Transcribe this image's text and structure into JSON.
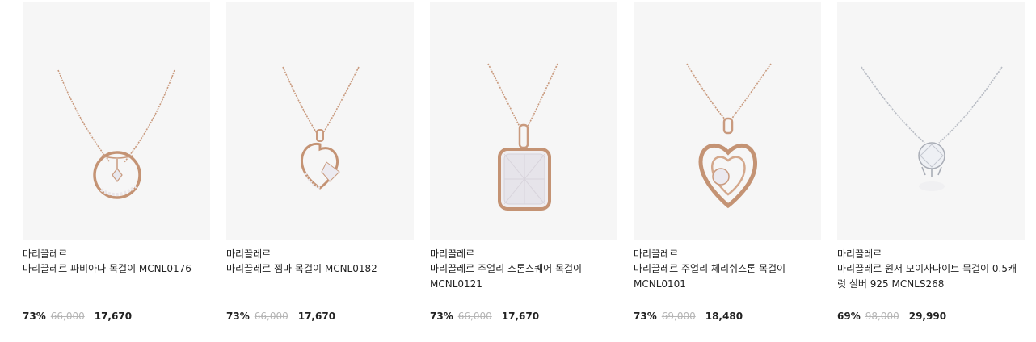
{
  "products": [
    {
      "brand": "마리끌레르",
      "name": "마리끌레르 파비아나 목걸이 MCNL0176",
      "discount": "73%",
      "original_price": "66,000",
      "sale_price": "17,670",
      "image_icon": "necklace-circle-pendant-icon",
      "metal_color": "#c99a7e"
    },
    {
      "brand": "마리끌레르",
      "name": "마리끌레르 젬마 목걸이 MCNL0182",
      "discount": "73%",
      "original_price": "66,000",
      "sale_price": "17,670",
      "image_icon": "necklace-heart-pendant-icon",
      "metal_color": "#c99a7e"
    },
    {
      "brand": "마리끌레르",
      "name": "마리끌레르 주얼리 스톤스퀘어 목걸이 MCNL0121",
      "discount": "73%",
      "original_price": "66,000",
      "sale_price": "17,670",
      "image_icon": "necklace-square-stone-icon",
      "metal_color": "#c99a7e"
    },
    {
      "brand": "마리끌레르",
      "name": "마리끌레르 주얼리 체리쉬스톤 목걸이 MCNL0101",
      "discount": "73%",
      "original_price": "69,000",
      "sale_price": "18,480",
      "image_icon": "necklace-double-heart-icon",
      "metal_color": "#c99a7e"
    },
    {
      "brand": "마리끌레르",
      "name": "마리끌레르 원저 모이사나이트 목걸이 0.5캐럿 실버 925 MCNLS268",
      "discount": "69%",
      "original_price": "98,000",
      "sale_price": "29,990",
      "image_icon": "necklace-solitaire-icon",
      "metal_color": "#b8bcc4"
    }
  ]
}
